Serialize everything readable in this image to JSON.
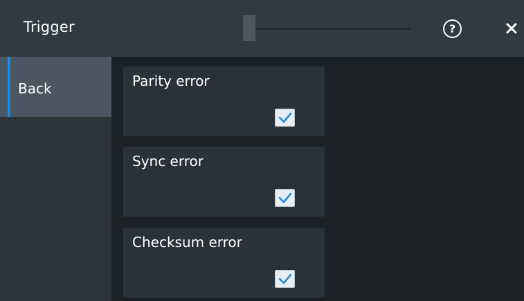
{
  "header": {
    "title": "Trigger",
    "help_label": "?",
    "help_icon": "question-circle-icon",
    "close_icon": "close-icon",
    "slider_position": 0
  },
  "sidebar": {
    "back_label": "Back",
    "accent_color": "#1e88e5"
  },
  "options": [
    {
      "label": "Parity error",
      "checked": true
    },
    {
      "label": "Sync error",
      "checked": true
    },
    {
      "label": "Checksum error",
      "checked": true
    }
  ],
  "colors": {
    "checkmark": "#1e88e5",
    "header_bg": "#313a43",
    "sidebar_selected": "#4a5763"
  }
}
